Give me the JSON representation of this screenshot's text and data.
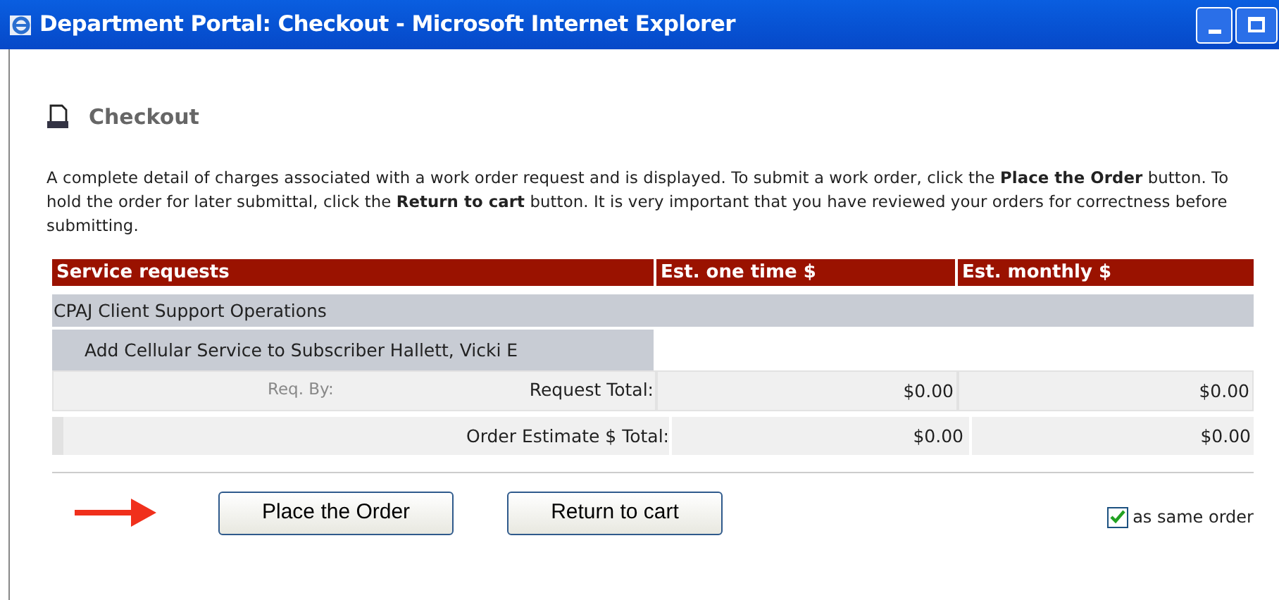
{
  "window": {
    "title": "Department Portal: Checkout - Microsoft Internet Explorer"
  },
  "page": {
    "heading": "Checkout",
    "description": "A complete detail of charges associated with a work order request and is displayed. To submit a work order, click the **Place the Order** button. To hold the order for later submittal, click the **Return to cart** button. It is very important that you have reviewed your orders for correctness before submitting."
  },
  "table": {
    "columns": [
      "Service requests",
      "Est. one time $",
      "Est. monthly $"
    ],
    "rows": [
      {
        "kind": "group",
        "label": "CPAJ Client Support Operations"
      },
      {
        "kind": "item",
        "label": "Add Cellular Service to Subscriber Hallett, Vicki E"
      },
      {
        "kind": "subtotal",
        "note": "Req. By:",
        "label": "Request Total:",
        "one_time": "$0.00",
        "monthly": "$0.00"
      },
      {
        "kind": "total",
        "label": "Order Estimate $ Total:",
        "one_time": "$0.00",
        "monthly": "$0.00"
      }
    ]
  },
  "buttons": [
    {
      "label": "Place the Order"
    },
    {
      "label": "Return to cart"
    }
  ],
  "same_order": {
    "label": "as same order",
    "checked": true
  }
}
